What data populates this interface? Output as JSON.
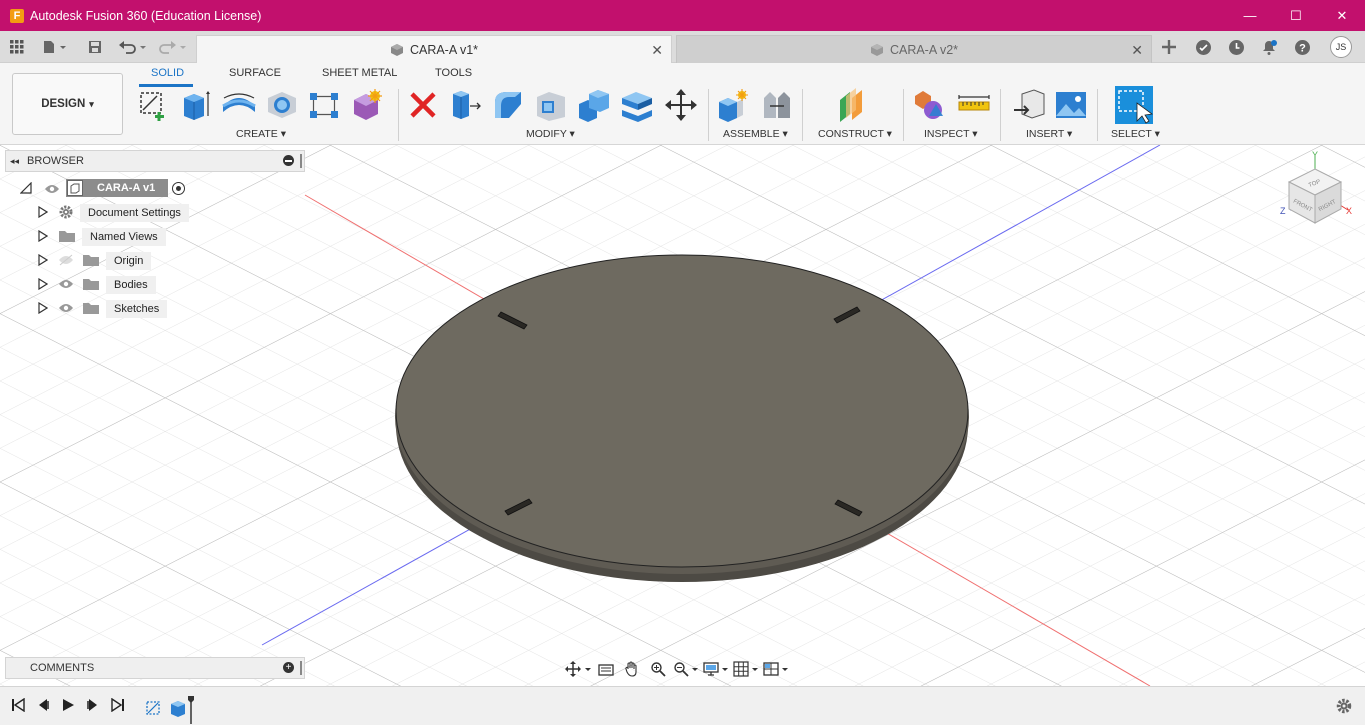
{
  "window": {
    "title": "Autodesk Fusion 360 (Education License)",
    "logo_letter": "F",
    "minimize_glyph": "—",
    "maximize_glyph": "☐",
    "close_glyph": "✕"
  },
  "tabs": [
    {
      "label": "CARA-A v1*",
      "active": true
    },
    {
      "label": "CARA-A v2*",
      "active": false
    }
  ],
  "user": {
    "initials": "JS"
  },
  "ribbon": {
    "workspace": "DESIGN",
    "workspace_arrow": "▾",
    "tabs": [
      "SOLID",
      "SURFACE",
      "SHEET METAL",
      "TOOLS"
    ],
    "groups": {
      "create": "CREATE ▾",
      "modify": "MODIFY ▾",
      "assemble": "ASSEMBLE ▾",
      "construct": "CONSTRUCT ▾",
      "inspect": "INSPECT ▾",
      "insert": "INSERT ▾",
      "select": "SELECT ▾"
    }
  },
  "browser": {
    "title": "BROWSER",
    "collapse_glyph": "◂◂",
    "root": "CARA-A v1",
    "items": [
      {
        "label": "Document Settings"
      },
      {
        "label": "Named Views"
      },
      {
        "label": "Origin"
      },
      {
        "label": "Bodies"
      },
      {
        "label": "Sketches"
      }
    ]
  },
  "comments": {
    "title": "COMMENTS"
  },
  "viewcube": {
    "faces": [
      "TOP",
      "FRONT",
      "RIGHT"
    ],
    "axes": [
      "Y",
      "Z",
      "X"
    ]
  },
  "colors": {
    "titlebar": "#c2106d",
    "accent": "#1b74c6",
    "disc_top": "#6e6a60",
    "disc_edge": "#5a5650"
  }
}
